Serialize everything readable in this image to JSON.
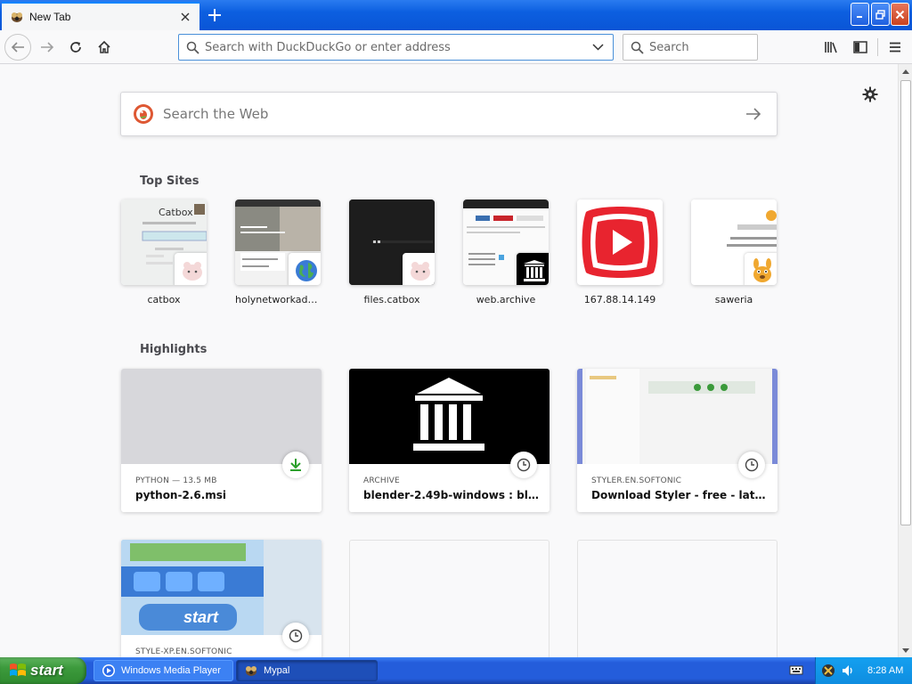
{
  "tab": {
    "title": "New Tab"
  },
  "navbar": {
    "url_placeholder": "Search with DuckDuckGo or enter address",
    "search_placeholder": "Search"
  },
  "content": {
    "web_search_placeholder": "Search the Web",
    "top_sites_title": "Top Sites",
    "highlights_title": "Highlights",
    "top_sites": [
      {
        "label": "catbox"
      },
      {
        "label": "holynetworkadapt..."
      },
      {
        "label": "files.catbox"
      },
      {
        "label": "web.archive"
      },
      {
        "label": "167.88.14.149"
      },
      {
        "label": "saweria"
      }
    ],
    "highlights": [
      {
        "meta": "PYTHON — 13.5 MB",
        "title": "python-2.6.msi",
        "icon": "download-icon"
      },
      {
        "meta": "ARCHIVE",
        "title": "blender-2.49b-windows : blende...",
        "icon": "clock-icon"
      },
      {
        "meta": "STYLER.EN.SOFTONIC",
        "title": "Download Styler - free - latest v...",
        "icon": "clock-icon"
      },
      {
        "meta": "STYLE-XP.EN.SOFTONIC",
        "title": "",
        "icon": "clock-icon"
      }
    ]
  },
  "taskbar": {
    "start_label": "start",
    "tasks": [
      {
        "label": "Windows Media Player"
      },
      {
        "label": "Mypal"
      }
    ],
    "clock": "8:28 AM"
  },
  "colors": {
    "accent": "#0a84ff",
    "download_green": "#2ca02c",
    "xp_blue": "#245ddb",
    "start_green": "#3c9a3c"
  }
}
